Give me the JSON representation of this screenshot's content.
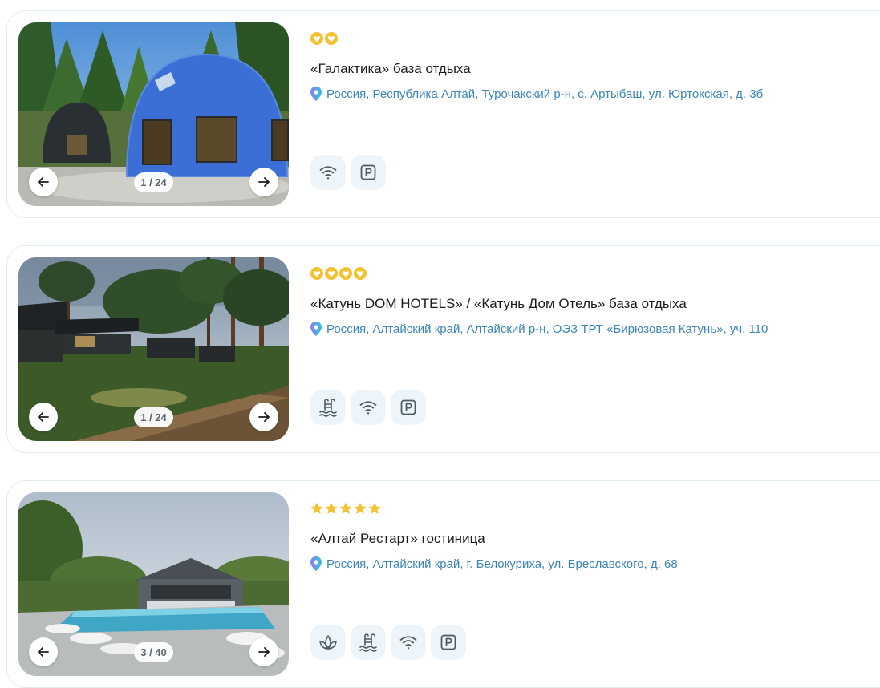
{
  "colors": {
    "star": "#f2c231",
    "address": "#3b85b8",
    "pin_a": "#7b8de6",
    "pin_b": "#41b6e6",
    "amenity_bg": "#edf5fb",
    "amenity_icon": "#4e5c66",
    "card_border": "#dfecef"
  },
  "hotels": [
    {
      "rating": {
        "count": 2,
        "style": "circle-heart"
      },
      "title": "«Галактика» база отдыха",
      "address": "Россия, Республика Алтай, Турочакский р-н, с. Артыбаш, ул. Юртокская, д. 3б",
      "photo": {
        "counter": "1 / 24",
        "scene": "blue-dome-in-forest"
      },
      "amenities": [
        "wifi-icon",
        "parking-icon"
      ]
    },
    {
      "rating": {
        "count": 4,
        "style": "circle-heart"
      },
      "title": "«Катунь DOM HOTELS» / «Катунь Дом Отель» база отдыха",
      "address": "Россия, Алтайский край, Алтайский р-н, ОЭЗ ТРТ «Бирюзовая Катунь», уч. 110",
      "photo": {
        "counter": "1 / 24",
        "scene": "dark-chalets-in-pine-forest"
      },
      "amenities": [
        "pool-icon",
        "wifi-icon",
        "parking-icon"
      ]
    },
    {
      "rating": {
        "count": 5,
        "style": "star"
      },
      "title": "«Алтай Рестарт» гостиница",
      "address": "Россия, Алтайский край, г. Белокуриха, ул. Бреславского, д. 68",
      "photo": {
        "counter": "3 / 40",
        "scene": "hotel-with-pool"
      },
      "amenities": [
        "spa-icon",
        "pool-icon",
        "wifi-icon",
        "parking-icon"
      ]
    }
  ]
}
